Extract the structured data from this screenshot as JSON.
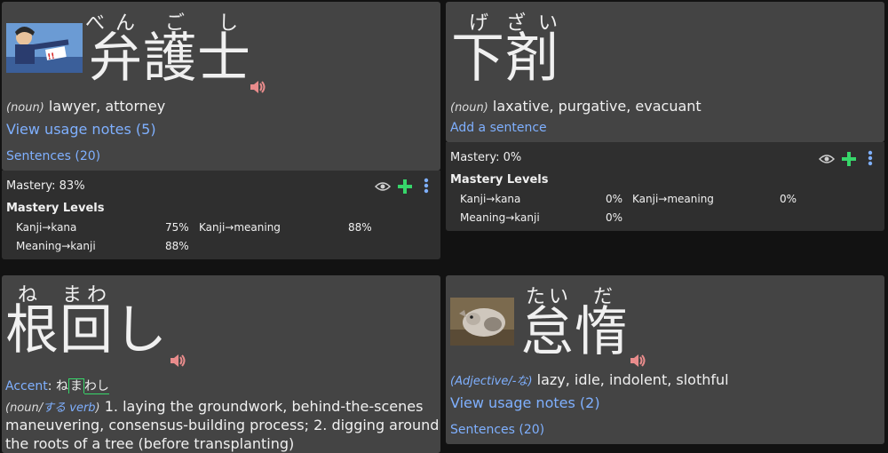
{
  "cards": [
    {
      "furigana": [
        "べ",
        "ん",
        "ご",
        "し"
      ],
      "kanji": "弁護士",
      "pos": "(noun)",
      "meaning": "lawyer, attorney",
      "notes_link": "View usage notes (5)",
      "sentences_link": "Sentences (20)",
      "mastery": "Mastery: 83%",
      "levels_title": "Mastery Levels",
      "levels": [
        {
          "label": "Kanji→kana",
          "value": "75%"
        },
        {
          "label": "Kanji→meaning",
          "value": "88%"
        },
        {
          "label": "Meaning→kanji",
          "value": "88%"
        }
      ]
    },
    {
      "furigana": [
        "げ",
        "ざ",
        "い"
      ],
      "kanji": "下剤",
      "pos": "(noun)",
      "meaning": "laxative, purgative, evacuant",
      "sentence_link": "Add a sentence",
      "mastery": "Mastery: 0%",
      "levels_title": "Mastery Levels",
      "levels": [
        {
          "label": "Kanji→kana",
          "value": "0%"
        },
        {
          "label": "Kanji→meaning",
          "value": "0%"
        },
        {
          "label": "Meaning→kanji",
          "value": "0%"
        }
      ]
    },
    {
      "furigana": [
        "ね",
        "ま",
        "わ"
      ],
      "kanji": "根回し",
      "accent_label": "Accent",
      "accent_sep": ":",
      "accent_pre": "ね",
      "accent_mark": "ま",
      "accent_post": "わし",
      "pos_open": "(noun/",
      "pos_link": "する verb",
      "pos_close": ")",
      "def_line1": " 1. laying the groundwork, behind-the-scenes",
      "def_line2": "maneuvering, consensus-building process; 2. digging around",
      "def_line3": "the roots of a tree (before transplanting)"
    },
    {
      "furigana": [
        "た",
        "い",
        "だ"
      ],
      "kanji": "怠惰",
      "pos": "(Adjective/-な)",
      "meaning": "lazy, idle, indolent, slothful",
      "notes_link": "View usage notes (2)",
      "sentences_link": "Sentences (20)"
    }
  ],
  "colors": {
    "card": "#444444",
    "stats": "#2f2f2f",
    "link": "#7fb0ff",
    "plus": "#37d66a",
    "speaker": "#e98c8c",
    "accent_box": "#37d66a"
  },
  "icons": [
    "speaker-icon",
    "eye-icon",
    "plus-icon",
    "more-vertical-icon"
  ]
}
